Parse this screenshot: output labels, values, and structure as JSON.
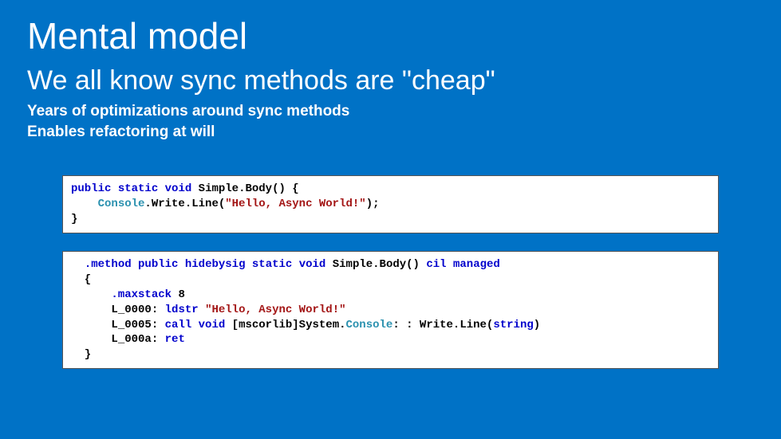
{
  "slide": {
    "title": "Mental model",
    "subtitle": "We all know sync methods are \"cheap\"",
    "bullets": [
      "Years of optimizations around sync methods",
      "Enables refactoring at will"
    ]
  },
  "code1": {
    "t1a": "public",
    "t1b": "static",
    "t1c": "void",
    "method": "Simple.Body() {",
    "indent": "    ",
    "console": "Console",
    "dot": ".",
    "call": "Write.Line(",
    "str": "\"Hello, Async World!\"",
    "end": ");",
    "close": "}"
  },
  "code2": {
    "pad": "  ",
    "l1a": ".method",
    "l1b": "public",
    "l1c": "hidebysig",
    "l1d": "static",
    "l1e": "void",
    "l1f": "Simple.Body()",
    "l1g": "cil",
    "l1h": "managed",
    "lb": "  {",
    "pad2": "      ",
    "l3a": ".maxstack",
    "l3b": " 8",
    "l4a": "L_0000: ",
    "l4b": "ldstr",
    "l4c": "\"Hello, Async World!\"",
    "l5a": "L_0005: ",
    "l5b": "call",
    "l5c": "void",
    "l5d": " [mscorlib]System.",
    "l5e": "Console",
    "l5f": ": : Write.Line(",
    "l5g": "string",
    "l5h": ")",
    "l6a": "L_000a: ",
    "l6b": "ret",
    "rb": "  }"
  }
}
